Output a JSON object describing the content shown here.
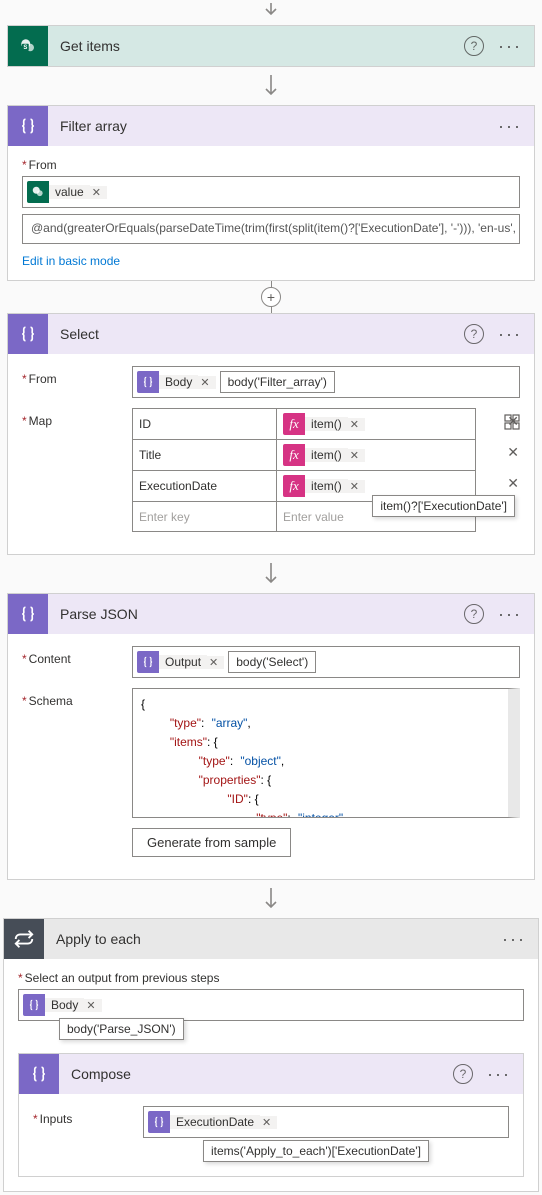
{
  "getItems": {
    "title": "Get items"
  },
  "filterArray": {
    "title": "Filter array",
    "fromLabel": "From",
    "fromToken": "value",
    "expression": "@and(greaterOrEquals(parseDateTime(trim(first(split(item()?['ExecutionDate'], '-'))), 'en-us', 'M/d/yy'),",
    "editLink": "Edit in basic mode"
  },
  "select": {
    "title": "Select",
    "fromLabel": "From",
    "fromToken": "Body",
    "fromTooltip": "body('Filter_array')",
    "mapLabel": "Map",
    "rows": [
      {
        "key": "ID",
        "valToken": "item()"
      },
      {
        "key": "Title",
        "valToken": "item()"
      },
      {
        "key": "ExecutionDate",
        "valToken": "item()"
      }
    ],
    "rowTooltip": "item()?['ExecutionDate']",
    "keyPlaceholder": "Enter key",
    "valPlaceholder": "Enter value"
  },
  "parseJson": {
    "title": "Parse JSON",
    "contentLabel": "Content",
    "contentToken": "Output",
    "contentTooltip": "body('Select')",
    "schemaLabel": "Schema",
    "generateBtn": "Generate from sample"
  },
  "applyEach": {
    "title": "Apply to each",
    "selectLabel": "Select an output from previous steps",
    "bodyToken": "Body",
    "bodyTooltip": "body('Parse_JSON')"
  },
  "compose": {
    "title": "Compose",
    "inputsLabel": "Inputs",
    "inputsToken": "ExecutionDate",
    "inputsTooltip": "items('Apply_to_each')['ExecutionDate']"
  }
}
